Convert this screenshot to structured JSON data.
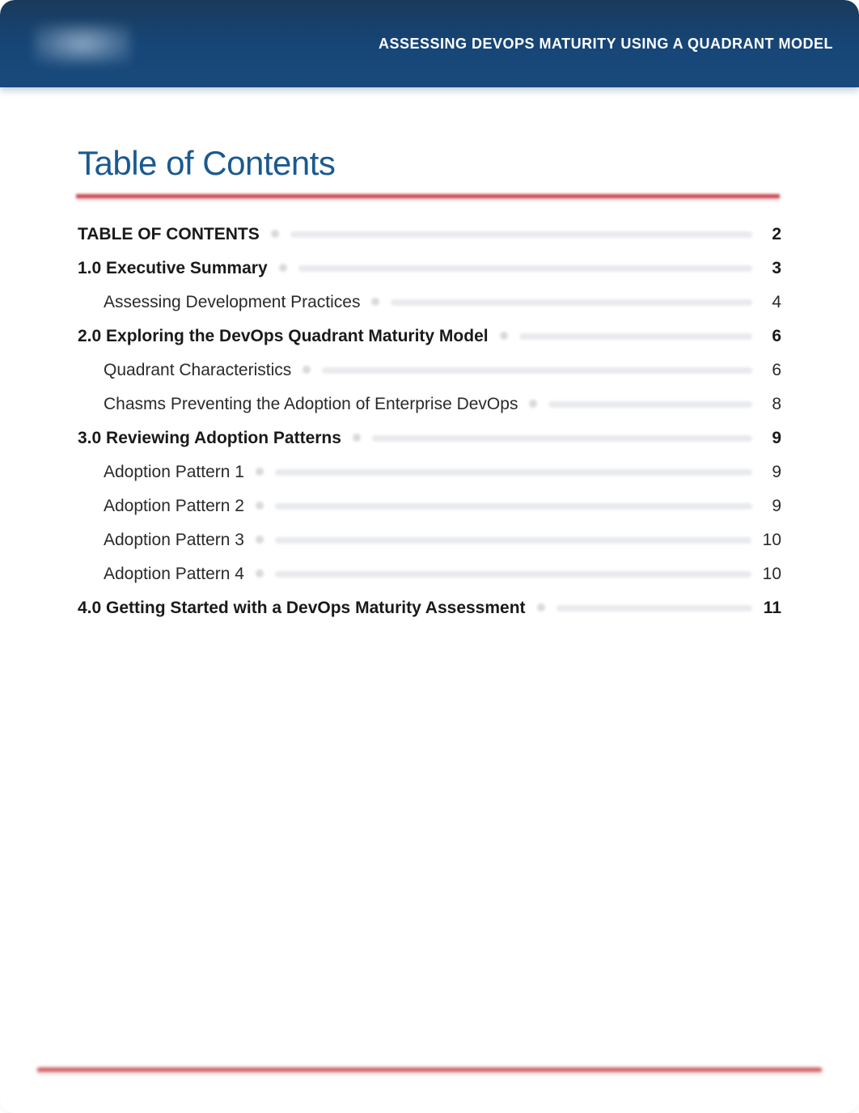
{
  "header": {
    "title": "ASSESSING DEVOPS MATURITY USING A QUADRANT MODEL"
  },
  "toc": {
    "heading": "Table of Contents",
    "entries": [
      {
        "label": "TABLE OF CONTENTS",
        "page": "2",
        "level": 0,
        "caps": true
      },
      {
        "label": "1.0 Executive Summary",
        "page": "3",
        "level": 0
      },
      {
        "label": "Assessing Development Practices",
        "page": "4",
        "level": 1
      },
      {
        "label": "2.0 Exploring the DevOps Quadrant Maturity Model",
        "page": "6",
        "level": 0
      },
      {
        "label": "Quadrant Characteristics",
        "page": "6",
        "level": 1
      },
      {
        "label": "Chasms Preventing the Adoption of Enterprise DevOps",
        "page": "8",
        "level": 1
      },
      {
        "label": "3.0 Reviewing Adoption Patterns",
        "page": "9",
        "level": 0
      },
      {
        "label": "Adoption Pattern 1",
        "page": "9",
        "level": 1
      },
      {
        "label": "Adoption Pattern 2",
        "page": "9",
        "level": 1
      },
      {
        "label": "Adoption Pattern 3",
        "page": "10",
        "level": 1
      },
      {
        "label": "Adoption Pattern 4",
        "page": "10",
        "level": 1
      },
      {
        "label": "4.0 Getting Started with a DevOps Maturity Assessment",
        "page": "11",
        "level": 0
      }
    ]
  }
}
